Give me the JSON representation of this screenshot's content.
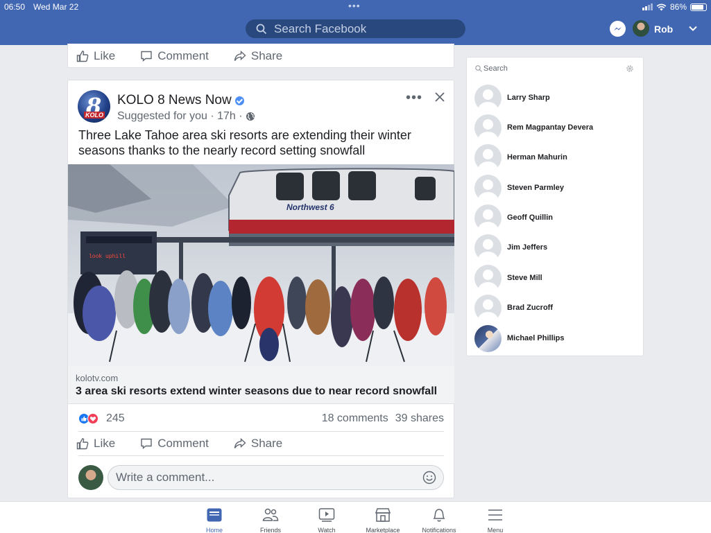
{
  "status": {
    "time": "06:50",
    "date": "Wed Mar 22",
    "battery": "86%",
    "battery_level": 0.86,
    "dots": "•••"
  },
  "header": {
    "search_placeholder": "Search Facebook",
    "user_name": "Rob"
  },
  "actions": {
    "like": "Like",
    "comment": "Comment",
    "share": "Share"
  },
  "post": {
    "page_name": "KOLO 8 News Now",
    "logo_number": "8",
    "logo_text": "KOLO",
    "meta": "Suggested for you · 17h ·",
    "more": "•••",
    "text": "Three Lake Tahoe area ski resorts are extending their winter seasons thanks to the nearly record setting snowfall",
    "link_domain": "kolotv.com",
    "link_title": "3 area ski resorts extend winter seasons due to near record snowfall",
    "reaction_count": "245",
    "comments": "18 comments",
    "shares": "39 shares",
    "comment_placeholder": "Write a comment..."
  },
  "contacts": {
    "search_placeholder": "Search",
    "items": [
      {
        "name": "Larry Sharp"
      },
      {
        "name": "Rem Magpantay Devera"
      },
      {
        "name": "Herman Mahurin"
      },
      {
        "name": "Steven Parmley"
      },
      {
        "name": "Geoff Quillin"
      },
      {
        "name": "Jim Jeffers"
      },
      {
        "name": "Steve Mill"
      },
      {
        "name": "Brad Zucroff"
      },
      {
        "name": "Michael Phillips"
      }
    ]
  },
  "tabs": [
    {
      "label": "Home",
      "icon": "home-icon",
      "active": true
    },
    {
      "label": "Friends",
      "icon": "friends-icon"
    },
    {
      "label": "Watch",
      "icon": "watch-icon"
    },
    {
      "label": "Marketplace",
      "icon": "marketplace-icon"
    },
    {
      "label": "Notifications",
      "icon": "bell-icon"
    },
    {
      "label": "Menu",
      "icon": "menu-icon"
    }
  ],
  "colors": {
    "brand": "#4267b2",
    "search_bg": "#29487d",
    "text": "#1c1e21",
    "secondary": "#606770",
    "like": "#1877f2",
    "love": "#f33e58"
  }
}
